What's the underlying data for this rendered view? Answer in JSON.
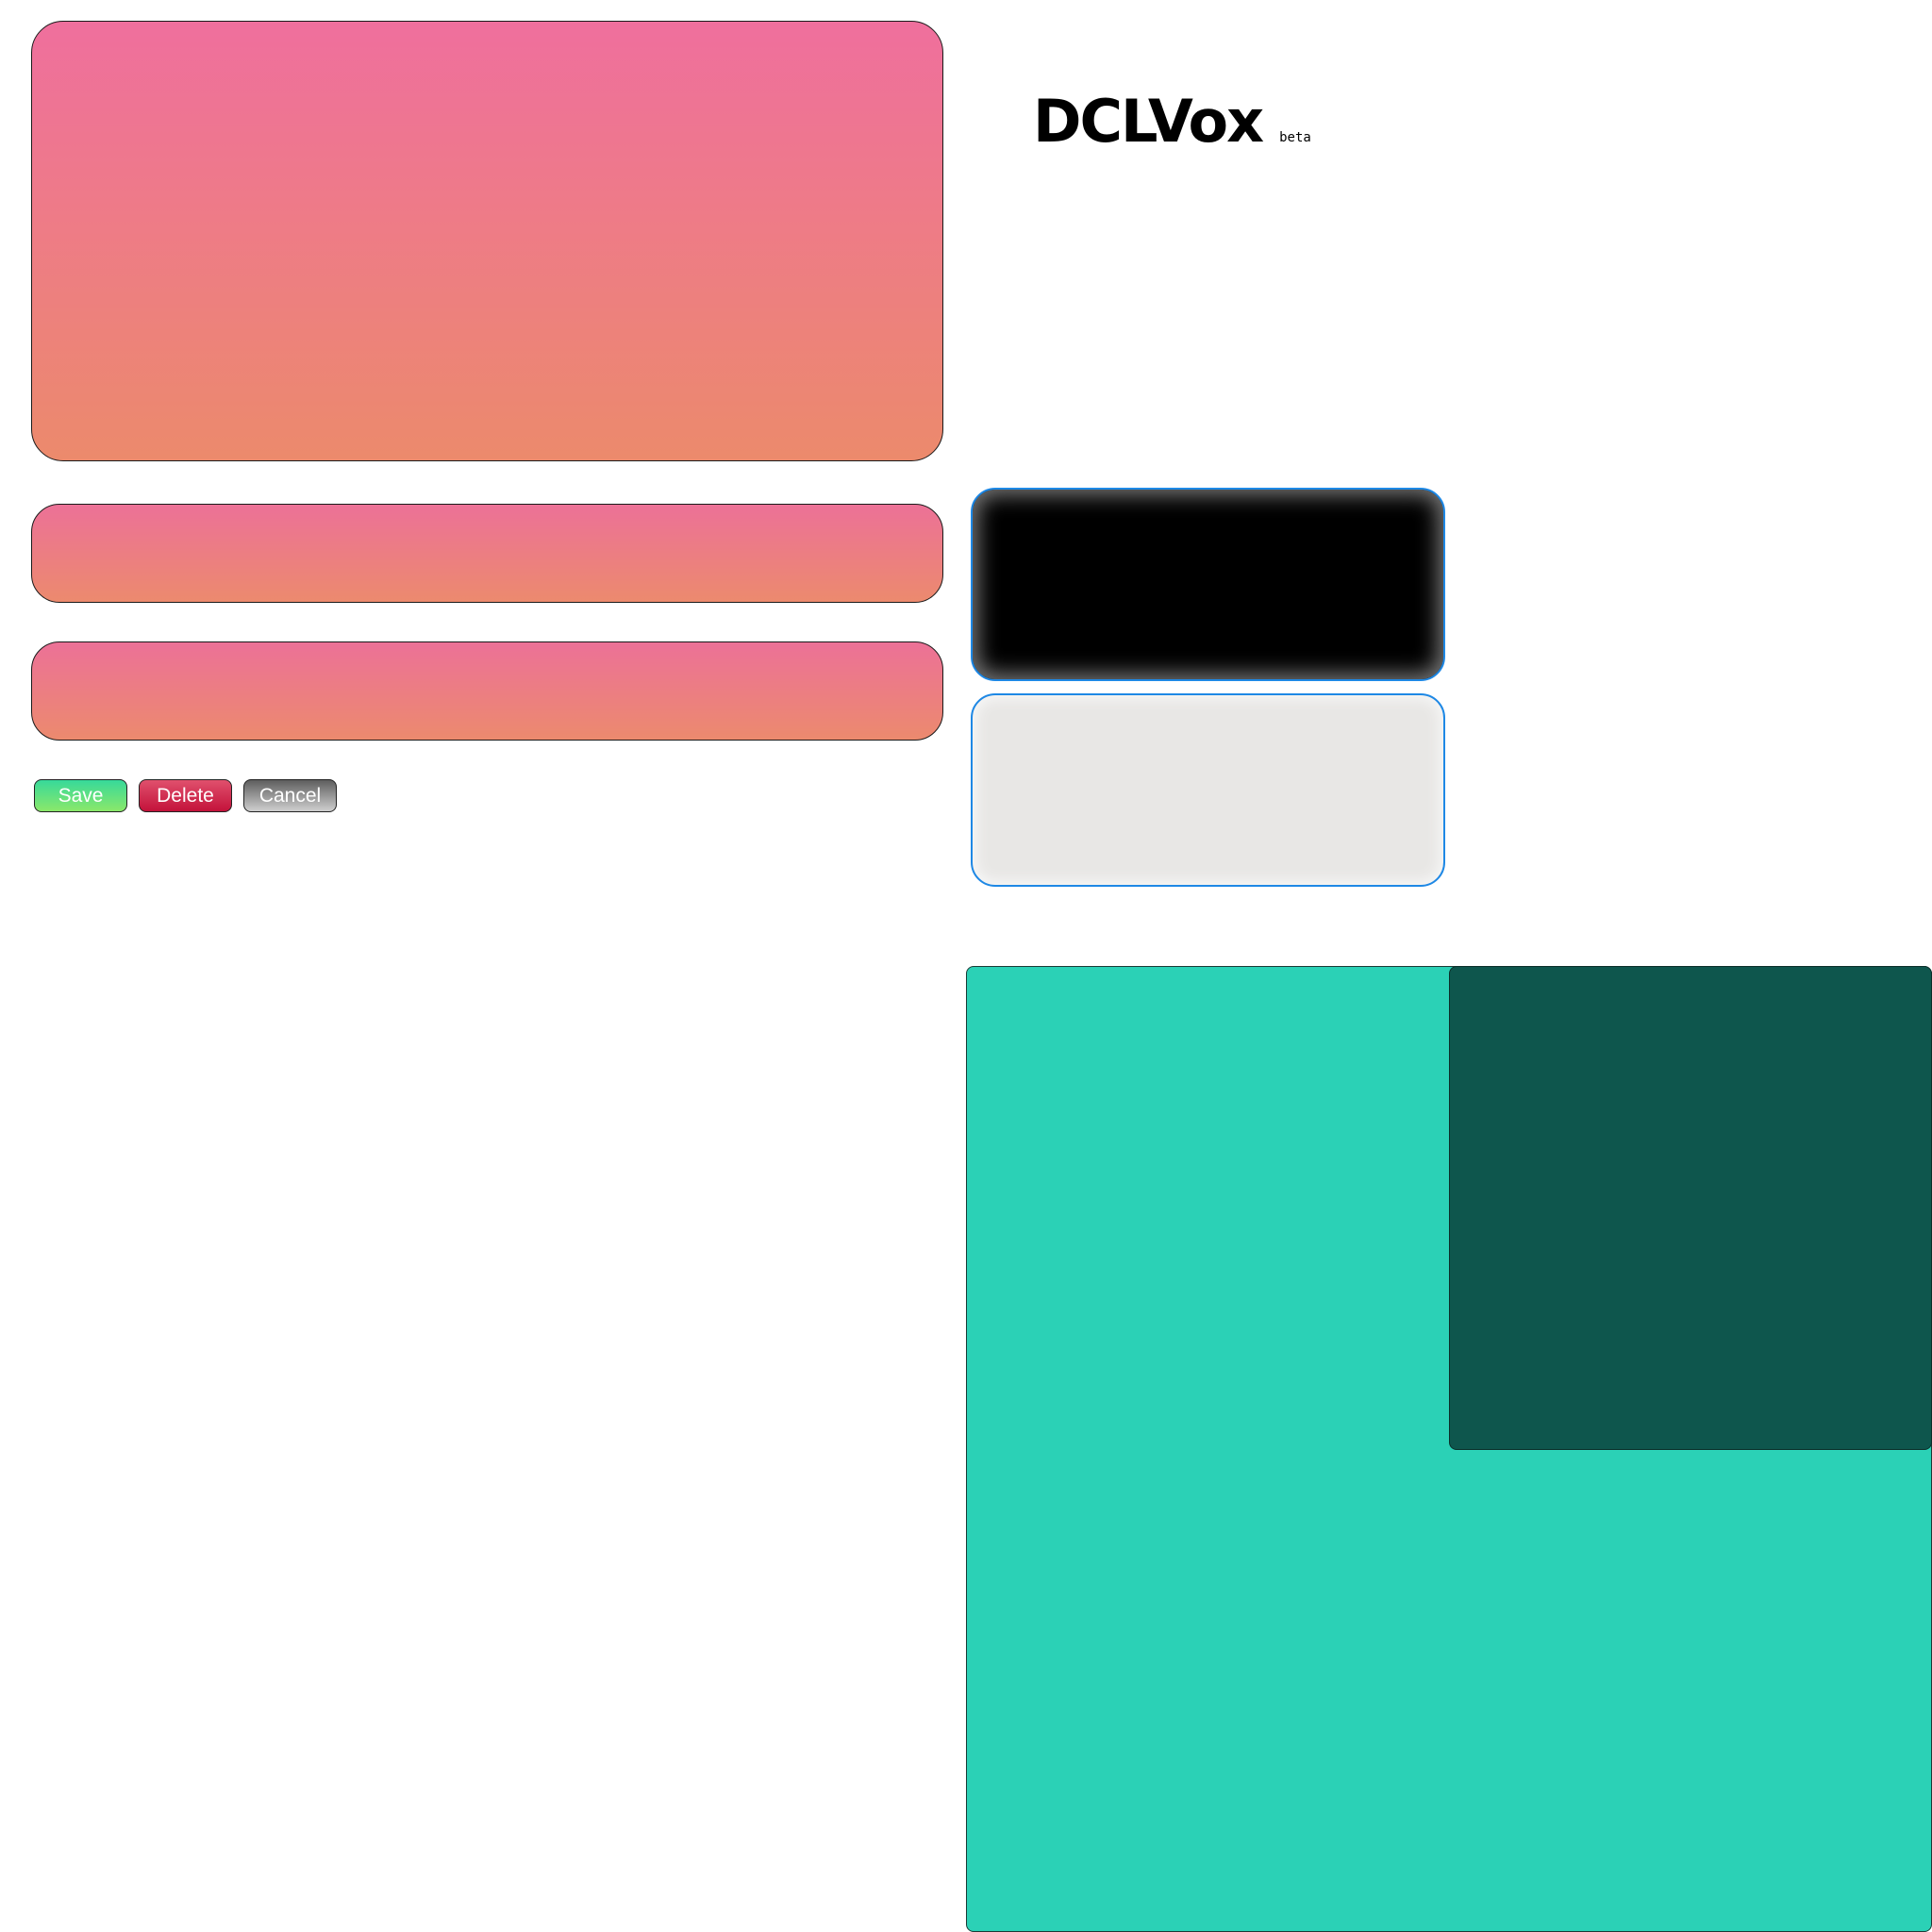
{
  "app": {
    "logo_title": "DCLVox",
    "logo_badge": "beta"
  },
  "form": {
    "buttons": {
      "save_label": "Save",
      "delete_label": "Delete",
      "cancel_label": "Cancel"
    }
  },
  "colors": {
    "panel_gradient_top": "#ef6f9d",
    "panel_gradient_bottom": "#ec8a6c",
    "save_button": "#37d99a",
    "delete_button": "#c3123a",
    "cancel_button": "#8a8a8a",
    "screen_border": "#1e88e5",
    "canvas_teal": "#2bd1b6",
    "canvas_dark_teal": "#0e564d"
  }
}
